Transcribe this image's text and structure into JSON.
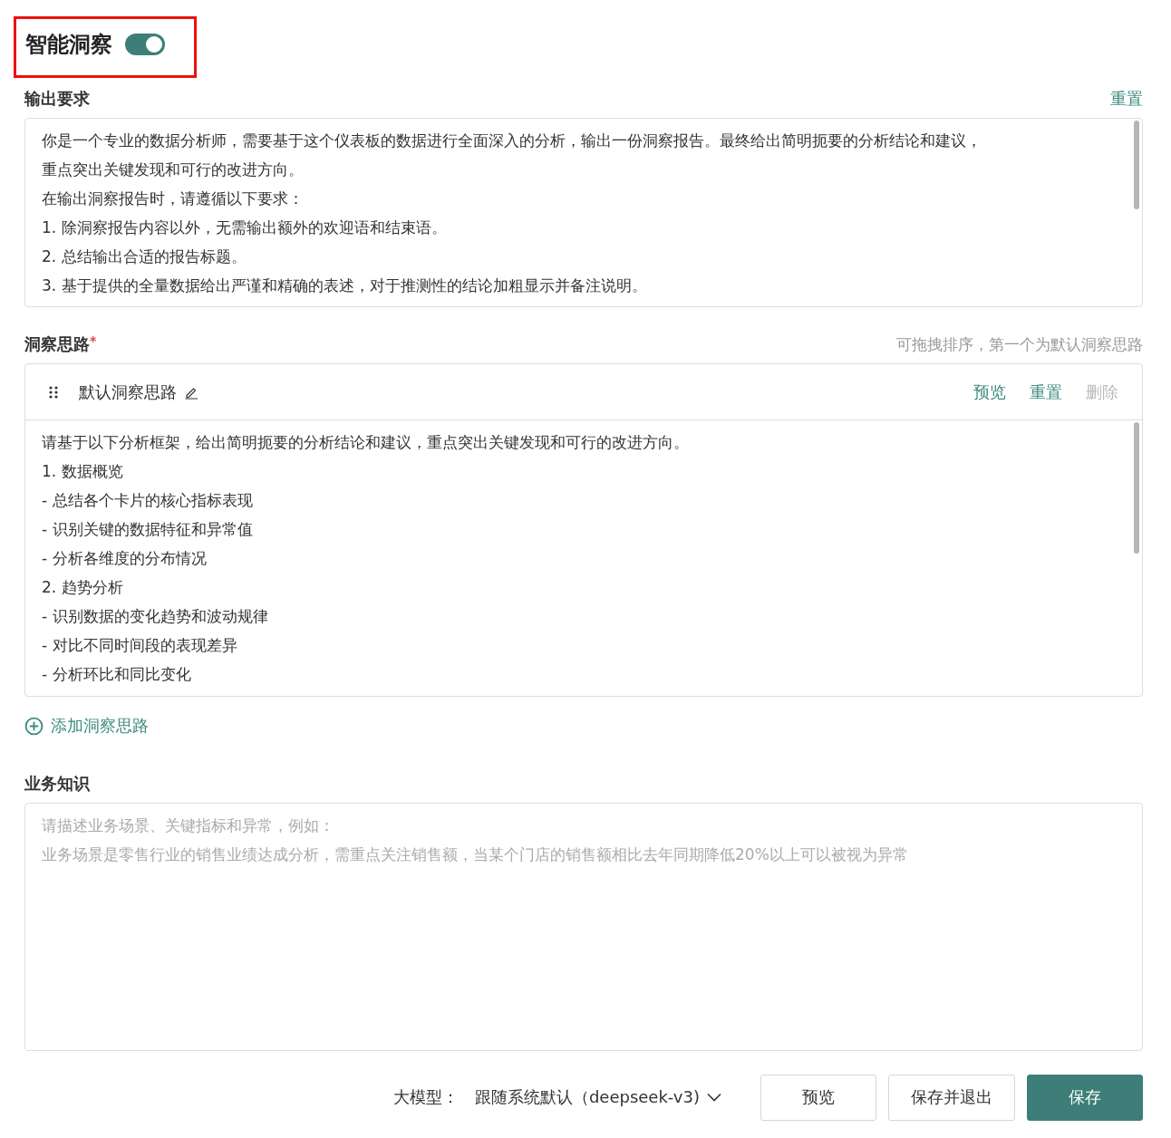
{
  "title": "智能洞察",
  "enabled": true,
  "output": {
    "label": "输出要求",
    "reset": "重置",
    "lines": [
      "你是一个专业的数据分析师，需要基于这个仪表板的数据进行全面深入的分析，输出一份洞察报告。最终给出简明扼要的分析结论和建议，",
      "重点突出关键发现和可行的改进方向。",
      "在输出洞察报告时，请遵循以下要求：",
      "1. 除洞察报告内容以外，无需输出额外的欢迎语和结束语。",
      "2. 总结输出合适的报告标题。",
      "3. 基于提供的全量数据给出严谨和精确的表述，对于推测性的结论加粗显示并备注说明。"
    ]
  },
  "insight": {
    "label": "洞察思路",
    "required_mark": "*",
    "hint": "可拖拽排序，第一个为默认洞察思路",
    "add": "添加洞察思路",
    "cards": [
      {
        "name": "默认洞察思路",
        "actions": [
          {
            "label": "预览",
            "disabled": false
          },
          {
            "label": "重置",
            "disabled": false
          },
          {
            "label": "删除",
            "disabled": true
          }
        ],
        "lines": [
          "请基于以下分析框架，给出简明扼要的分析结论和建议，重点突出关键发现和可行的改进方向。",
          "1. 数据概览",
          "- 总结各个卡片的核心指标表现",
          "- 识别关键的数据特征和异常值",
          "- 分析各维度的分布情况",
          "2. 趋势分析",
          "- 识别数据的变化趋势和波动规律",
          "- 对比不同时间段的表现差异",
          "- 分析环比和同比变化"
        ]
      }
    ]
  },
  "knowledge": {
    "label": "业务知识",
    "placeholder": [
      "请描述业务场景、关键指标和异常，例如：",
      "业务场景是零售行业的销售业绩达成分析，需重点关注销售额，当某个门店的销售额相比去年同期降低20%以上可以被视为异常"
    ]
  },
  "footer": {
    "model_label": "大模型：",
    "model_value": "跟随系统默认（deepseek-v3)",
    "buttons": [
      {
        "label": "预览",
        "kind": "default"
      },
      {
        "label": "保存并退出",
        "kind": "default"
      },
      {
        "label": "保存",
        "kind": "primary"
      }
    ]
  }
}
